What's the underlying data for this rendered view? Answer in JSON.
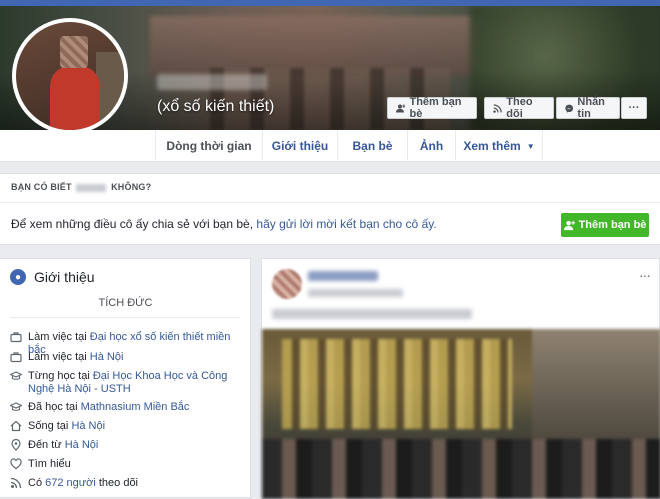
{
  "profile": {
    "alternate_name": "(xổ số kiến thiết)"
  },
  "cover_buttons": {
    "add_friend": "Thêm bạn bè",
    "follow": "Theo dõi",
    "message": "Nhắn tin",
    "more": "···"
  },
  "tabs": [
    {
      "label": "Dòng thời gian"
    },
    {
      "label": "Giới thiệu"
    },
    {
      "label": "Bạn bè"
    },
    {
      "label": "Ảnh"
    },
    {
      "label": "Xem thêm"
    }
  ],
  "know_box": {
    "title_prefix": "BẠN CÓ BIẾT",
    "title_suffix": "KHÔNG?",
    "text": "Để xem những điều cô ấy chia sẻ với bạn bè,",
    "link": "hãy gửi lời mời kết bạn cho cô ấy.",
    "button": "Thêm bạn bè"
  },
  "intro": {
    "title": "Giới thiệu",
    "bio": "TÍCH ĐỨC",
    "rows": [
      {
        "prefix": "Làm việc tại",
        "link": "Đại học xổ số kiến thiết miền bắc",
        "suffix": "",
        "icon": "briefcase-icon"
      },
      {
        "prefix": "Làm việc tại",
        "link": "Hà Nội",
        "suffix": "",
        "icon": "briefcase-icon"
      },
      {
        "prefix": "Từng học tại",
        "link": "Đại Học Khoa Học và Công Nghệ Hà Nội - USTH",
        "suffix": "",
        "icon": "graduation-cap-icon"
      },
      {
        "prefix": "Đã học tại",
        "link": "Mathnasium Miền Bắc",
        "suffix": "",
        "icon": "graduation-cap-icon"
      },
      {
        "prefix": "Sống tại",
        "link": "Hà Nội",
        "suffix": "",
        "icon": "home-icon"
      },
      {
        "prefix": "Đến từ",
        "link": "Hà Nội",
        "suffix": "",
        "icon": "location-pin-icon"
      },
      {
        "prefix": "Tìm hiểu",
        "link": "",
        "suffix": "",
        "icon": "heart-icon"
      },
      {
        "prefix": "Có",
        "link": "672 người",
        "suffix": "theo dõi",
        "icon": "follower-icon"
      }
    ]
  },
  "post": {
    "more": "···"
  },
  "colors": {
    "facebook_blue": "#4267b2",
    "link_blue": "#365899",
    "green_button": "#42b72a",
    "background": "#e9ebee"
  }
}
